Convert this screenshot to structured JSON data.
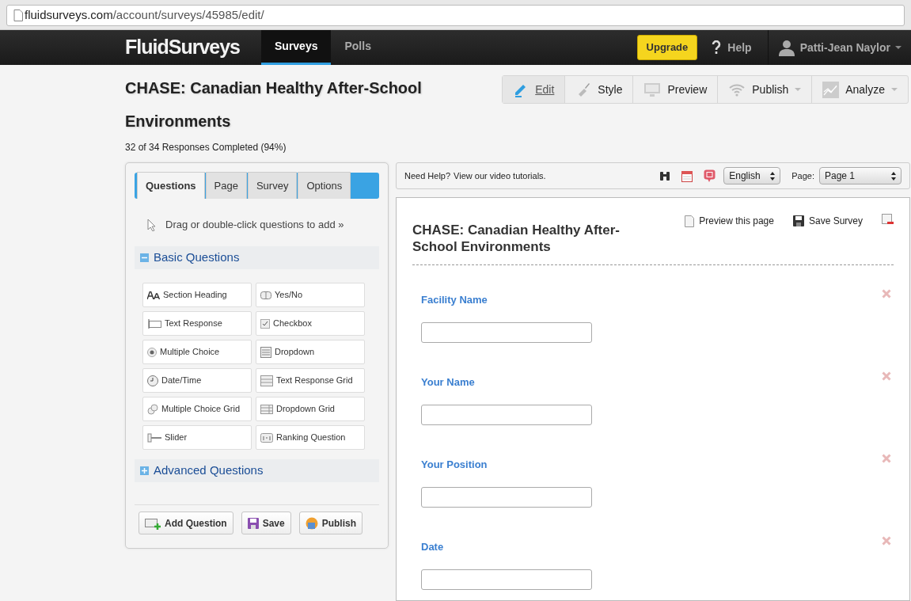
{
  "address_bar": {
    "host": "fluidsurveys.com",
    "path": "/account/surveys/45985/edit/"
  },
  "navbar": {
    "logo": "FluidSurveys",
    "items": [
      {
        "label": "Surveys",
        "selected": true
      },
      {
        "label": "Polls",
        "selected": false
      }
    ],
    "upgrade": "Upgrade",
    "help": "Help",
    "user": "Patti-Jean Naylor"
  },
  "survey_title": "CHASE: Canadian Healthy After-School Environments",
  "responses": "32 of 34 Responses Completed (94%)",
  "toolbar": [
    {
      "label": "Edit",
      "selected": true,
      "dropdown": false
    },
    {
      "label": "Style",
      "selected": false,
      "dropdown": false
    },
    {
      "label": "Preview",
      "selected": false,
      "dropdown": false
    },
    {
      "label": "Publish",
      "selected": false,
      "dropdown": true
    },
    {
      "label": "Analyze",
      "selected": false,
      "dropdown": true
    }
  ],
  "left_panel": {
    "tabs": [
      {
        "label": "Questions",
        "selected": true
      },
      {
        "label": "Page",
        "selected": false
      },
      {
        "label": "Survey",
        "selected": false
      },
      {
        "label": "Options",
        "selected": false
      }
    ],
    "hint": "Drag or double-click questions to add »",
    "sections": [
      {
        "title": "Basic Questions",
        "expanded": true,
        "items": [
          "Section Heading",
          "Yes/No",
          "Text Response",
          "Checkbox",
          "Multiple Choice",
          "Dropdown",
          "Date/Time",
          "Text Response Grid",
          "Multiple Choice Grid",
          "Dropdown Grid",
          "Slider",
          "Ranking Question"
        ]
      },
      {
        "title": "Advanced Questions",
        "expanded": false
      }
    ],
    "buttons": [
      "Add Question",
      "Save",
      "Publish"
    ]
  },
  "help_bar": {
    "text": "Need Help?",
    "link": "View our video tutorials.",
    "language": "English",
    "page_label": "Page:",
    "page": "Page 1"
  },
  "survey": {
    "title": "CHASE: Canadian Healthy After-School Environments",
    "actions": [
      "Preview this page",
      "Save Survey"
    ],
    "questions": [
      {
        "label": "Facility Name"
      },
      {
        "label": "Your Name"
      },
      {
        "label": "Your Position"
      },
      {
        "label": "Date"
      }
    ]
  }
}
